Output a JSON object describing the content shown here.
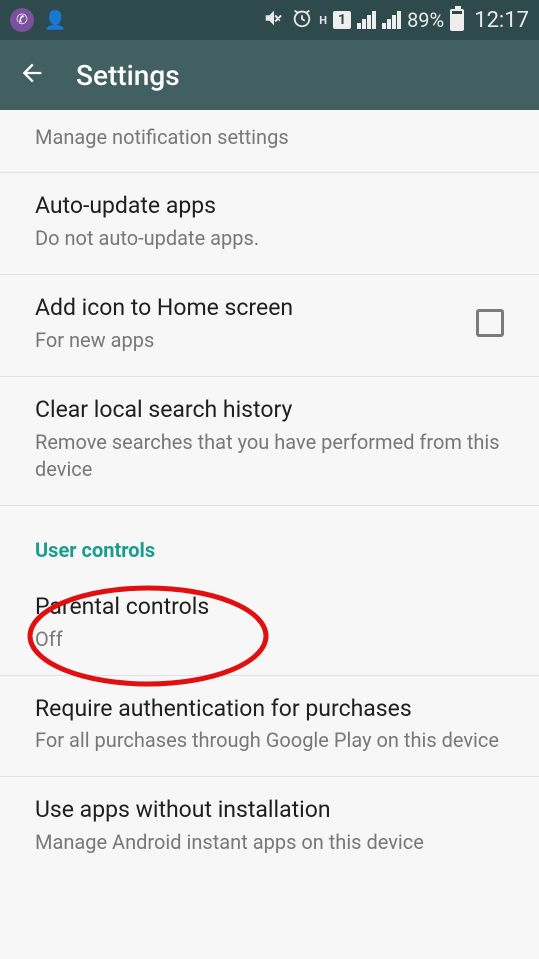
{
  "status": {
    "battery_pct": "89%",
    "time": "12:17",
    "data_label": "H",
    "sim_number": "1"
  },
  "header": {
    "title": "Settings"
  },
  "rows": {
    "notifications": {
      "title": "Manage notification settings"
    },
    "auto_update": {
      "title": "Auto-update apps",
      "sub": "Do not auto-update apps."
    },
    "add_icon": {
      "title": "Add icon to Home screen",
      "sub": "For new apps"
    },
    "clear_history": {
      "title": "Clear local search history",
      "sub": "Remove searches that you have performed from this device"
    },
    "parental": {
      "title": "Parental controls",
      "sub": "Off"
    },
    "require_auth": {
      "title": "Require authentication for purchases",
      "sub": "For all purchases through Google Play on this device"
    },
    "instant_apps": {
      "title": "Use apps without installation",
      "sub": "Manage Android instant apps on this device"
    }
  },
  "sections": {
    "user_controls": "User controls"
  }
}
